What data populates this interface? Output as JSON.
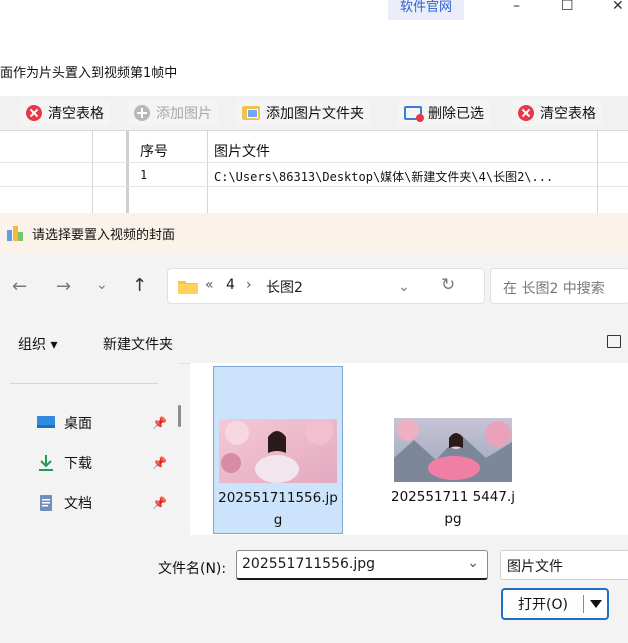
{
  "app": {
    "site_link": "软件官网",
    "win_minimize": "–",
    "win_maximize": "☐",
    "win_close": "✕",
    "instruction_text": "面作为片头置入到视频第1帧中",
    "toolbar": {
      "clear_table_1": "清空表格",
      "add_image": "添加图片",
      "add_image_folder": "添加图片文件夹",
      "delete_selected": "删除已选",
      "clear_table_2": "清空表格"
    },
    "table": {
      "col_index": "序号",
      "col_file": "图片文件",
      "rows": [
        {
          "index": "1",
          "file": "C:\\Users\\86313\\Desktop\\媒体\\新建文件夹\\4\\长图2\\..."
        }
      ]
    }
  },
  "dialog": {
    "title": "请选择要置入视频的封面",
    "nav": {
      "back": "←",
      "forward": "→",
      "history": "⌄",
      "up": "↑",
      "refresh": "↻",
      "dropdown": "⌄"
    },
    "breadcrumb": {
      "overflow": "«",
      "sep": "›",
      "parent": "4",
      "current": "长图2"
    },
    "search_placeholder": "在 长图2 中搜索",
    "commands": {
      "organize": "组织 ▾",
      "new_folder": "新建文件夹"
    },
    "nav_items": [
      {
        "label": "桌面",
        "icon": "desktop-icon"
      },
      {
        "label": "下载",
        "icon": "download-icon"
      },
      {
        "label": "文档",
        "icon": "documents-icon"
      }
    ],
    "pin_glyph": "📌",
    "files": [
      {
        "name": "202551711556.jpg",
        "selected": true
      },
      {
        "name": "202551711 5447.jpg",
        "selected": false
      }
    ],
    "filename_label": "文件名(N):",
    "filename_value": "202551711556.jpg",
    "filetype_value": "图片文件",
    "open_label": "打开(O)"
  },
  "colors": {
    "accent": "#1f6fc6",
    "selection": "#cce4fb",
    "danger": "#e8374a"
  }
}
